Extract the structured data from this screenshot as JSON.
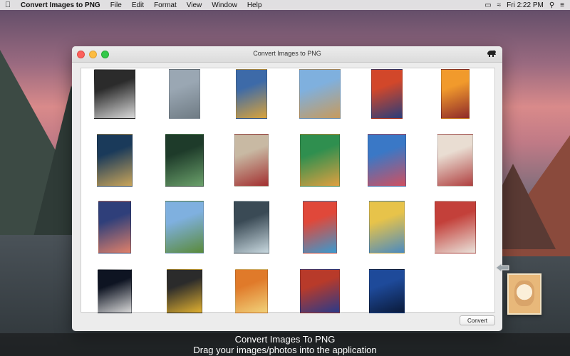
{
  "menubar": {
    "apple_icon": "apple-icon",
    "app_name": "Convert Images to PNG",
    "menus": [
      "File",
      "Edit",
      "Format",
      "View",
      "Window",
      "Help"
    ],
    "clock": "Fri 2:22 PM"
  },
  "window": {
    "title": "Convert Images to PNG",
    "convert_label": "Convert"
  },
  "thumbnails": [
    {
      "name": "apple-sketch",
      "colors": [
        "#2b2b2b",
        "#d9d9d9"
      ]
    },
    {
      "name": "floating-rock",
      "colors": [
        "#9aa7b3",
        "#6f7b84"
      ]
    },
    {
      "name": "colorful-ladder",
      "colors": [
        "#3d6aa8",
        "#d9a33b"
      ]
    },
    {
      "name": "iceberg-cone",
      "colors": [
        "#7fb0de",
        "#c79a5c"
      ]
    },
    {
      "name": "sunset-city-painting",
      "colors": [
        "#d2472a",
        "#2a3d7a"
      ]
    },
    {
      "name": "sailboat-painting",
      "colors": [
        "#f19a2c",
        "#8e2a2a"
      ]
    },
    {
      "name": "forest-night",
      "colors": [
        "#1a3a5a",
        "#c9a55a"
      ]
    },
    {
      "name": "woman-face-green",
      "colors": [
        "#1e3b2a",
        "#6aa06a"
      ]
    },
    {
      "name": "street-art-girl",
      "colors": [
        "#c8b9a3",
        "#a33030"
      ]
    },
    {
      "name": "rainbow-stairs",
      "colors": [
        "#2f8f4f",
        "#e0a040"
      ]
    },
    {
      "name": "mermaid-stairs",
      "colors": [
        "#3a78c6",
        "#d05060"
      ]
    },
    {
      "name": "double-exposure-girl",
      "colors": [
        "#e9ddd2",
        "#b04040"
      ]
    },
    {
      "name": "face-galaxy",
      "colors": [
        "#2f3f7a",
        "#e0806a"
      ]
    },
    {
      "name": "tree-heart",
      "colors": [
        "#7fb0df",
        "#5a8a3a"
      ]
    },
    {
      "name": "waterfall-face",
      "colors": [
        "#3a4a55",
        "#c8d8df"
      ]
    },
    {
      "name": "rainbow-lion",
      "colors": [
        "#e0483a",
        "#3a9ad0"
      ]
    },
    {
      "name": "lemon-city",
      "colors": [
        "#e7c34a",
        "#4a8ac0"
      ]
    },
    {
      "name": "red-hair-portrait",
      "colors": [
        "#c3403a",
        "#e9e2da"
      ]
    },
    {
      "name": "moon-landscape",
      "colors": [
        "#0e1422",
        "#d8d8d8"
      ]
    },
    {
      "name": "afro-color-portrait",
      "colors": [
        "#2b2b2b",
        "#e0b030"
      ]
    },
    {
      "name": "orange-hair-woman",
      "colors": [
        "#e07a2a",
        "#f1d27a"
      ]
    },
    {
      "name": "dancer-painting",
      "colors": [
        "#b83a2a",
        "#2a3a8a"
      ]
    },
    {
      "name": "sailboat-blue",
      "colors": [
        "#1e4a9a",
        "#0a1a3a"
      ]
    }
  ],
  "caption": {
    "line1": "Convert Images To PNG",
    "line2": "Drag your images/photos into the application"
  }
}
